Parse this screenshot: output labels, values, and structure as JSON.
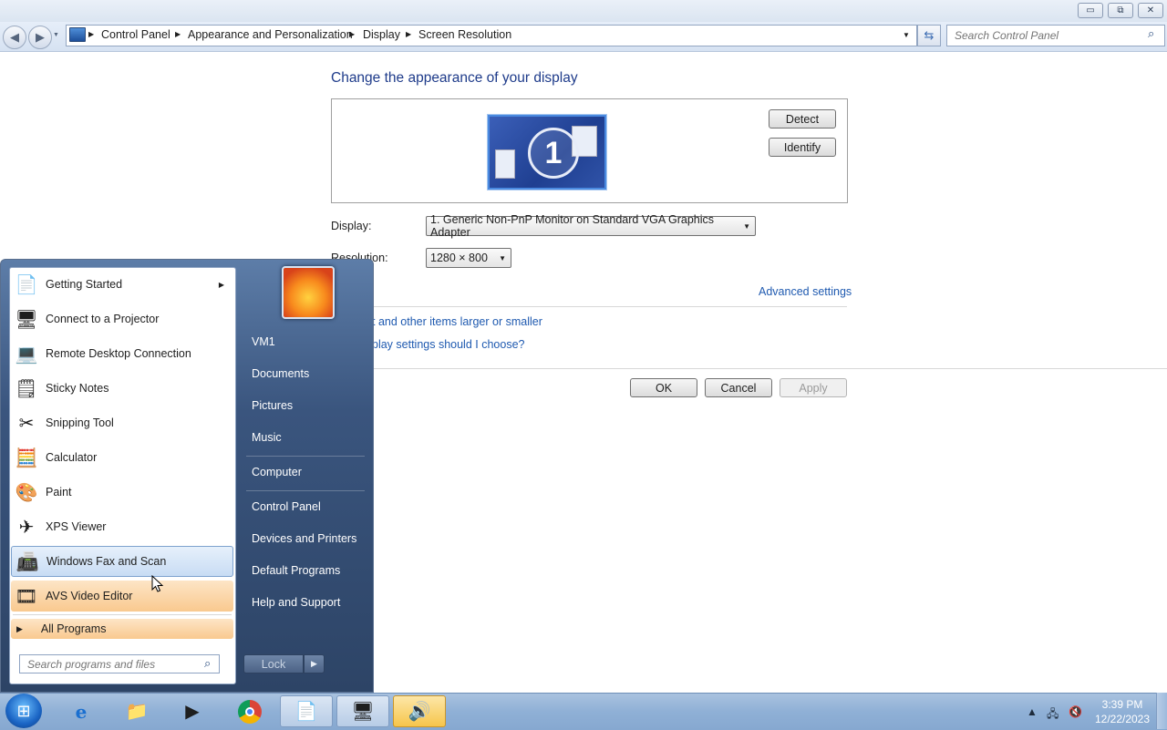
{
  "window": {
    "minimize_glyph": "▭",
    "maximize_glyph": "⧉",
    "close_glyph": "✕"
  },
  "address_bar": {
    "breadcrumbs": [
      "Control Panel",
      "Appearance and Personalization",
      "Display",
      "Screen Resolution"
    ],
    "search_placeholder": "Search Control Panel"
  },
  "main": {
    "heading": "Change the appearance of your display",
    "monitor_number": "1",
    "detect_label": "Detect",
    "identify_label": "Identify",
    "display_label": "Display:",
    "display_value": "1. Generic Non-PnP Monitor on Standard VGA Graphics Adapter",
    "resolution_label": "Resolution:",
    "resolution_value": "1280 × 800",
    "advanced_link": "Advanced settings",
    "link_larger": "t and other items larger or smaller",
    "link_which": "play settings should I choose?",
    "ok_label": "OK",
    "cancel_label": "Cancel",
    "apply_label": "Apply"
  },
  "start_menu": {
    "programs": [
      {
        "label": "Getting Started",
        "icon": "getting-started-icon",
        "has_submenu": true
      },
      {
        "label": "Connect to a Projector",
        "icon": "projector-icon"
      },
      {
        "label": "Remote Desktop Connection",
        "icon": "remote-desktop-icon"
      },
      {
        "label": "Sticky Notes",
        "icon": "sticky-notes-icon"
      },
      {
        "label": "Snipping Tool",
        "icon": "snipping-tool-icon"
      },
      {
        "label": "Calculator",
        "icon": "calculator-icon"
      },
      {
        "label": "Paint",
        "icon": "paint-icon"
      },
      {
        "label": "XPS Viewer",
        "icon": "xps-viewer-icon"
      },
      {
        "label": "Windows Fax and Scan",
        "icon": "fax-scan-icon"
      },
      {
        "label": "AVS Video Editor",
        "icon": "avs-video-editor-icon"
      }
    ],
    "all_programs": "All Programs",
    "search_placeholder": "Search programs and files",
    "right_links": [
      "VM1",
      "Documents",
      "Pictures",
      "Music",
      "Computer",
      "Control Panel",
      "Devices and Printers",
      "Default Programs",
      "Help and Support"
    ],
    "lock_label": "Lock"
  },
  "taskbar": {
    "time": "3:39 PM",
    "date": "12/22/2023"
  }
}
